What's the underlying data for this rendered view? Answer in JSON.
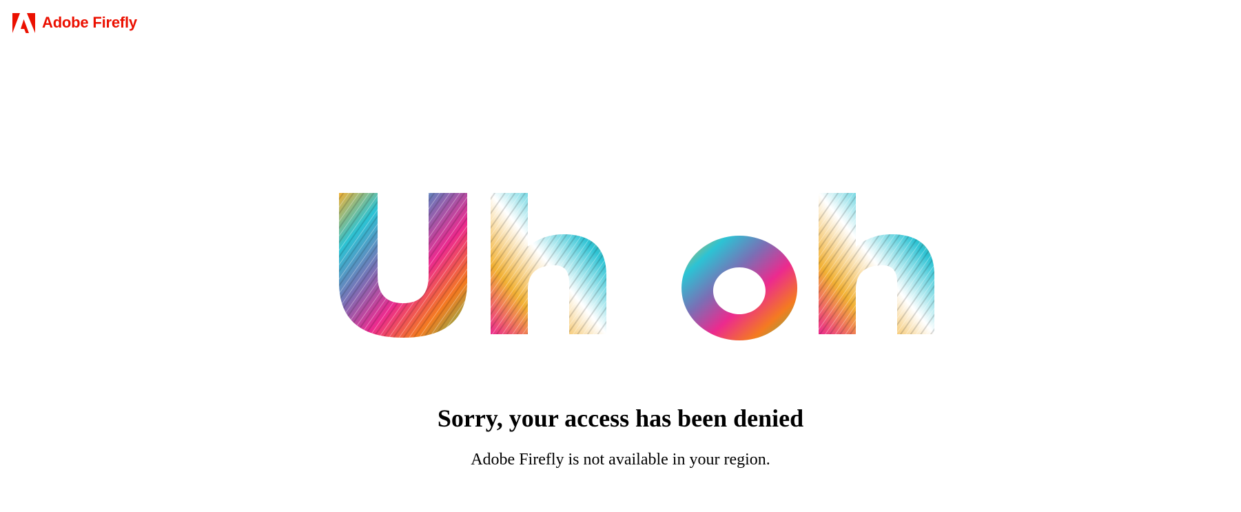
{
  "brand": {
    "name": "Adobe Firefly",
    "color": "#eb1000",
    "logo_icon": "adobe-logo-icon"
  },
  "hero": {
    "text": "Uh oh",
    "style": "multicolor-fur-lettering",
    "colors": [
      "#f2b134",
      "#2cc3d4",
      "#ec2a8e",
      "#f47b20",
      "#7a6fb5",
      "#5fbf5a",
      "#ffffff"
    ]
  },
  "message": {
    "title": "Sorry, your access has been denied",
    "subtitle": "Adobe Firefly is not available in your region."
  }
}
